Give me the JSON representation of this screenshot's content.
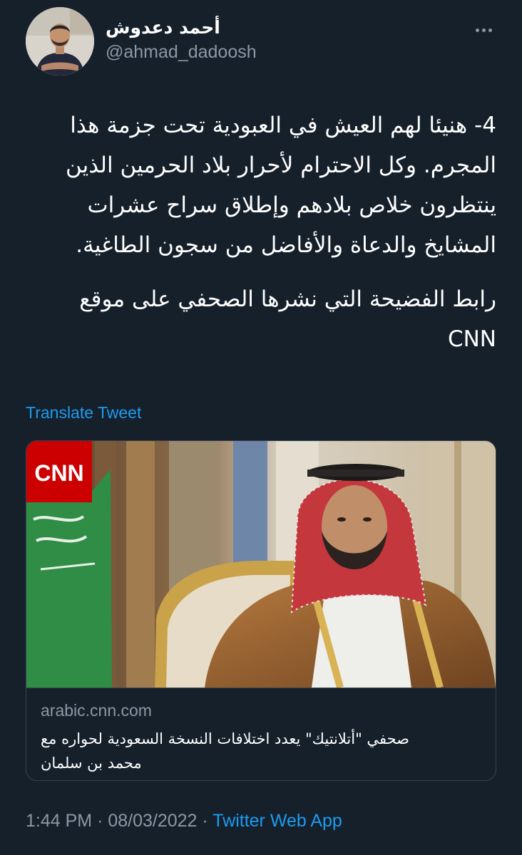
{
  "author": {
    "display_name": "أحمد دعدوش",
    "handle": "@ahmad_dadoosh"
  },
  "tweet": {
    "paragraph_1": "4- هنيئا لهم العيش في العبودية تحت جزمة هذا المجرم. وكل الاحترام لأحرار بلاد الحرمين الذين ينتظرون خلاص بلادهم وإطلاق سراح عشرات المشايخ والدعاة والأفاضل من سجون الطاغية.",
    "paragraph_2": "رابط الفضيحة التي نشرها الصحفي على موقع CNN",
    "translate_label": "Translate Tweet"
  },
  "card": {
    "logo_text": "CNN",
    "domain": "arabic.cnn.com",
    "title": "صحفي \"أتلانتيك\" يعدد اختلافات النسخة السعودية لحواره مع محمد بن سلمان"
  },
  "footer": {
    "time": "1:44 PM",
    "separator": "·",
    "date": "08/03/2022",
    "source": "Twitter Web App"
  },
  "colors": {
    "background": "#15202b",
    "link": "#1d9bf0",
    "secondary_text": "#8b98a5",
    "border": "#38444d",
    "cnn_red": "#cc0000"
  }
}
